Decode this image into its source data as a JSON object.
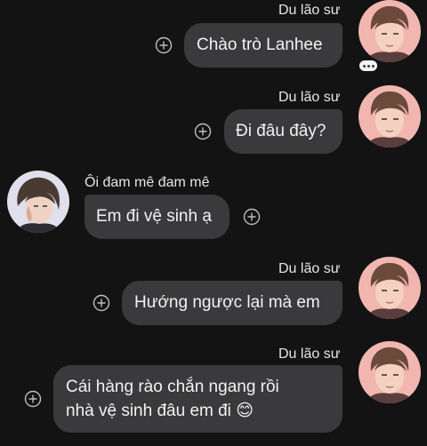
{
  "messages": [
    {
      "sender": "Du lão sư",
      "side": "right",
      "text": "Chào trò Lanhee",
      "reactions": "typing-indicator"
    },
    {
      "sender": "Du lão sư",
      "side": "right",
      "text": "Đi đâu đây?"
    },
    {
      "sender": "Ôi đam mê đam mê",
      "side": "left",
      "text": "Em đi vệ sinh ạ"
    },
    {
      "sender": "Du lão sư",
      "side": "right",
      "text": "Hướng ngược lại mà em"
    },
    {
      "sender": "Du lão sư",
      "side": "right",
      "lines": [
        "Cái hàng rào chắn ngang rồi",
        "nhà vệ sinh đâu em đi"
      ],
      "emoji": "😊"
    }
  ],
  "colors": {
    "background": "#131313",
    "bubble": "#3a3a3c",
    "text": "#f2f2f2",
    "avatar_teacher_bg": "#f2b6b0",
    "avatar_student_bg": "#dfe0ec"
  },
  "icons": {
    "add_reaction": "circle-plus-icon",
    "typing": "typing-dots-icon"
  }
}
